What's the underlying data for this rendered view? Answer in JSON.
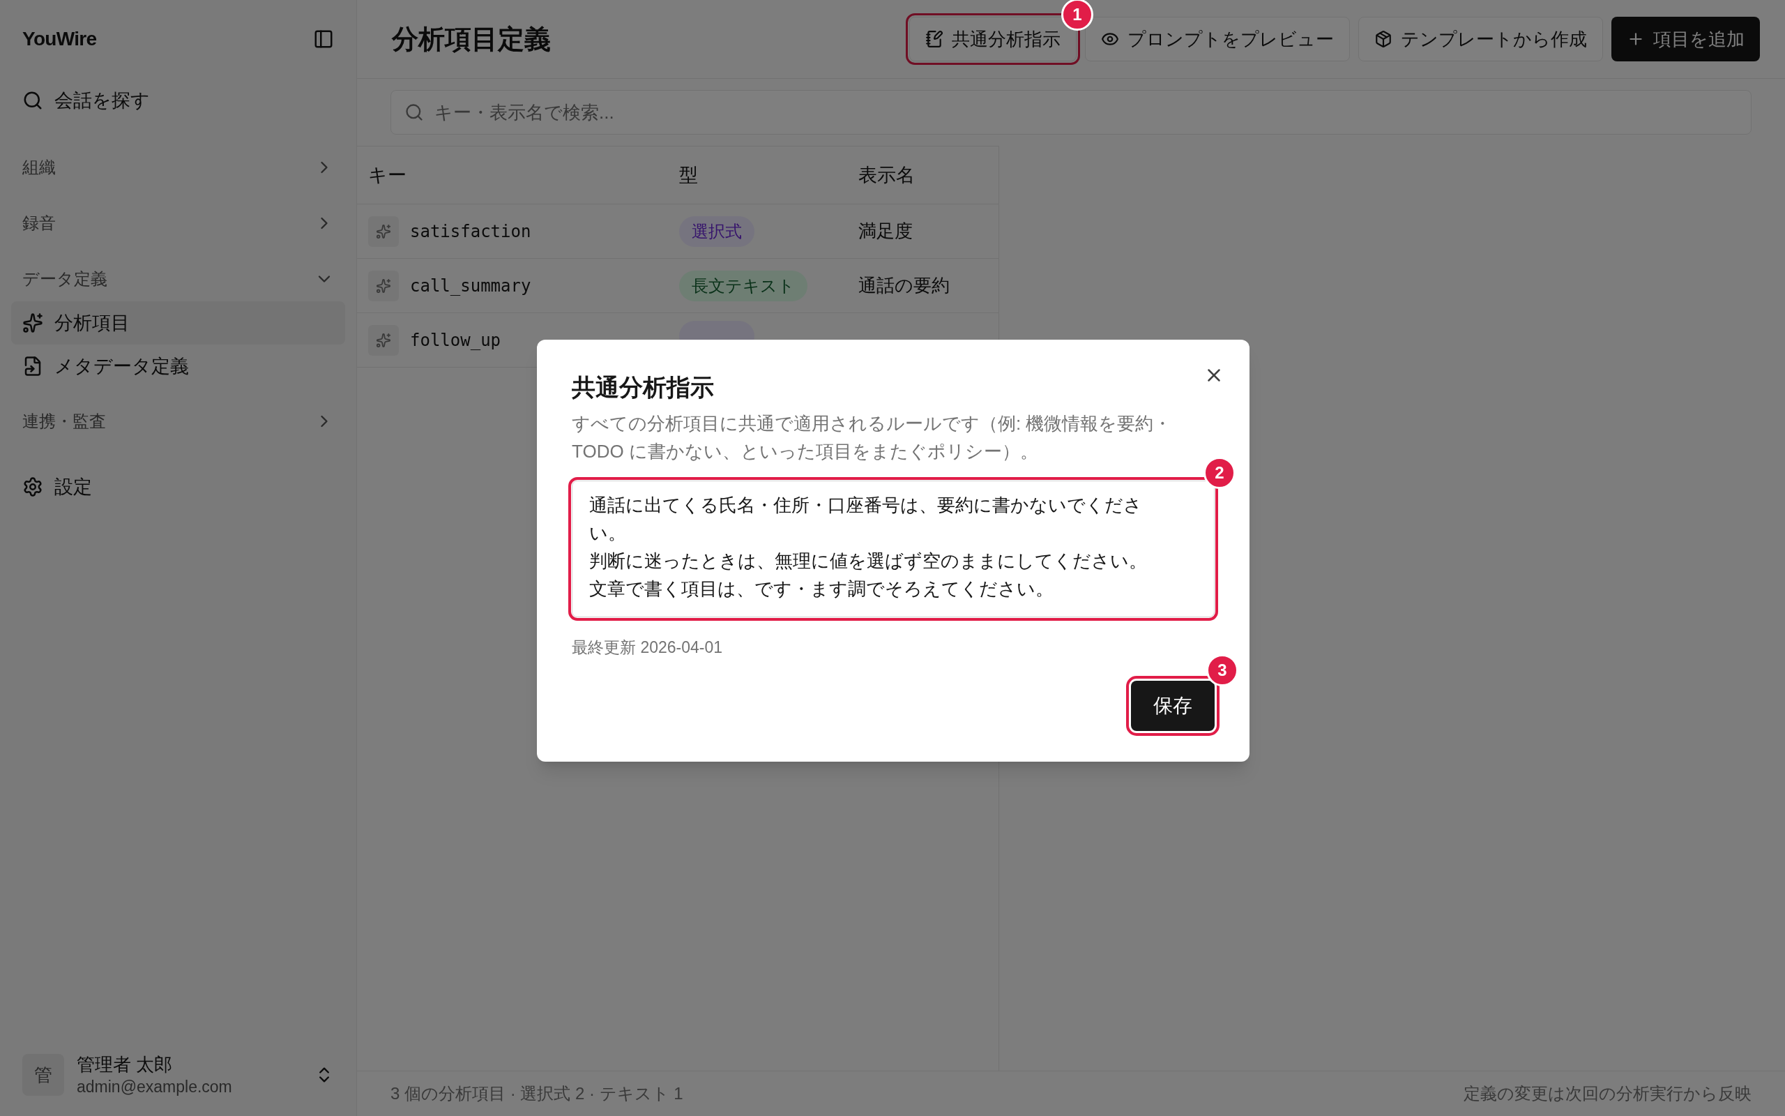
{
  "sidebar": {
    "brand": "YouWire",
    "search_item": "会話を探す",
    "sections": [
      {
        "label": "組織",
        "expanded": false
      },
      {
        "label": "録音",
        "expanded": false
      },
      {
        "label": "データ定義",
        "expanded": true,
        "items": [
          {
            "label": "分析項目",
            "selected": true
          },
          {
            "label": "メタデータ定義",
            "selected": false
          }
        ]
      },
      {
        "label": "連携・監査",
        "expanded": false
      }
    ],
    "settings": "設定",
    "user": {
      "avatar": "管",
      "name": "管理者 太郎",
      "email": "admin@example.com"
    }
  },
  "header": {
    "title": "分析項目定義",
    "buttons": [
      {
        "label": "共通分析指示",
        "kind": "outline",
        "callout": "1"
      },
      {
        "label": "プロンプトをプレビュー",
        "kind": "outline"
      },
      {
        "label": "テンプレートから作成",
        "kind": "outline"
      },
      {
        "label": "項目を追加",
        "kind": "primary"
      }
    ]
  },
  "search": {
    "placeholder": "キー・表示名で検索..."
  },
  "table": {
    "columns": [
      "キー",
      "型",
      "表示名"
    ],
    "rows": [
      {
        "key": "satisfaction",
        "type": "選択式",
        "kind": "choice",
        "display_name": "満足度"
      },
      {
        "key": "call_summary",
        "type": "長文テキスト",
        "kind": "text",
        "display_name": "通話の要約"
      },
      {
        "key": "follow_up",
        "kind": "choice"
      }
    ]
  },
  "status_bar": {
    "left": "3 個の分析項目 · 選択式 2 · テキスト 1",
    "right": "定義の変更は次回の分析実行から反映"
  },
  "dialog": {
    "title": "共通分析指示",
    "description": "すべての分析項目に共通で適用されるルールです（例: 機微情報を要約・TODO に書かない、といった項目をまたぐポリシー）。",
    "lines": [
      "通話に出てくる氏名・住所・口座番号は、要約に書かないでください。",
      "判断に迷ったときは、無理に値を選ばず空のままにしてください。",
      "文章で書く項目は、です・ます調でそろえてください。"
    ],
    "textarea_callout": "2",
    "updated": "最終更新 2026-04-01",
    "save_button": "保存",
    "save_callout": "3"
  }
}
